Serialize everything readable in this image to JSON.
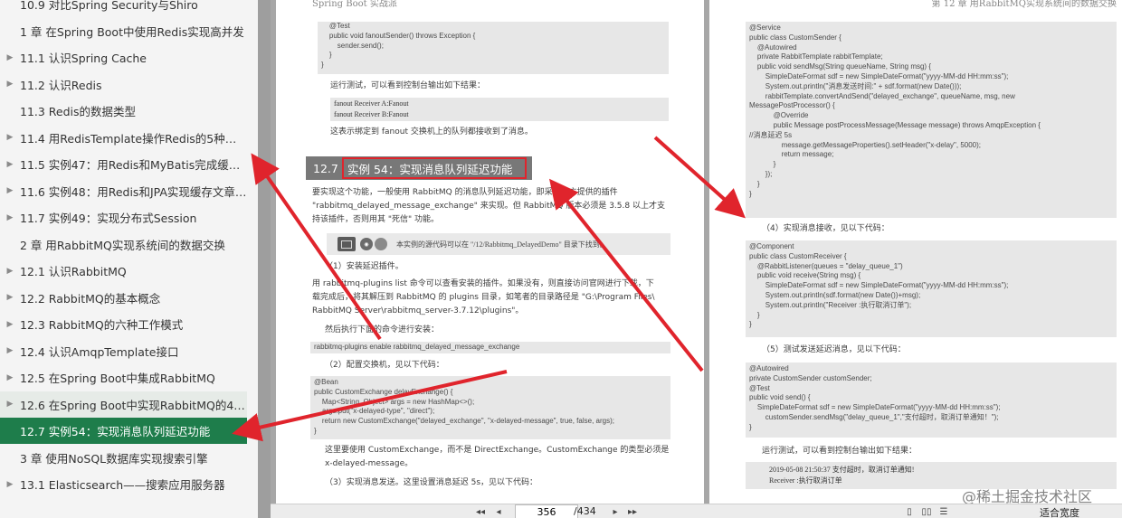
{
  "sidebar": {
    "items": [
      {
        "label": "10.9 对比Spring Security与Shiro",
        "chevron": false,
        "state": "normal"
      },
      {
        "label": "1 章 在Spring Boot中使用Redis实现高并发",
        "chevron": false,
        "state": "normal"
      },
      {
        "label": "11.1 认识Spring Cache",
        "chevron": true,
        "state": "normal"
      },
      {
        "label": "11.2 认识Redis",
        "chevron": true,
        "state": "normal"
      },
      {
        "label": "11.3 Redis的数据类型",
        "chevron": false,
        "state": "normal"
      },
      {
        "label": "11.4 用RedisTemplate操作Redis的5种数据...",
        "chevron": true,
        "state": "normal"
      },
      {
        "label": "11.5 实例47：用Redis和MyBatis完成缓存数...",
        "chevron": true,
        "state": "normal"
      },
      {
        "label": "11.6 实例48：用Redis和JPA实现缓存文章和...",
        "chevron": true,
        "state": "normal"
      },
      {
        "label": "11.7 实例49：实现分布式Session",
        "chevron": true,
        "state": "normal"
      },
      {
        "label": "2 章 用RabbitMQ实现系统间的数据交换",
        "chevron": false,
        "state": "normal"
      },
      {
        "label": "12.1 认识RabbitMQ",
        "chevron": true,
        "state": "normal"
      },
      {
        "label": "12.2 RabbitMQ的基本概念",
        "chevron": true,
        "state": "normal"
      },
      {
        "label": "12.3 RabbitMQ的六种工作模式",
        "chevron": true,
        "state": "normal"
      },
      {
        "label": "12.4 认识AmqpTemplate接口",
        "chevron": true,
        "state": "normal"
      },
      {
        "label": "12.5 在Spring Boot中集成RabbitMQ",
        "chevron": true,
        "state": "normal"
      },
      {
        "label": "12.6 在Spring Boot中实现RabbitMQ的4种...",
        "chevron": true,
        "state": "hover"
      },
      {
        "label": "12.7 实例54：实现消息队列延迟功能",
        "chevron": false,
        "state": "active"
      },
      {
        "label": "3 章 使用NoSQL数据库实现搜索引擎",
        "chevron": false,
        "state": "normal"
      },
      {
        "label": "13.1 Elasticsearch——搜索应用服务器",
        "chevron": true,
        "state": "normal"
      }
    ]
  },
  "left_page": {
    "running_head": "Spring Boot 实战派",
    "code1": "    @Test\n    public void fanoutSender() throws Exception {\n        sender.send();\n    }\n}",
    "para1": "运行测试，可以看到控制台输出如下结果：",
    "output1": "fanout Receiver A:Fanout\nfanout Receiver B:Fanout",
    "para2": "这表示绑定到 fanout 交换机上的队列都接收到了消息。",
    "section_number": "12.7",
    "section_title": "实例 54：实现消息队列延迟功能",
    "para3": "要实现这个功能，一般使用 RabbitMQ 的消息队列延迟功能，即采用官方提供的插件\n\"rabbitmq_delayed_message_exchange\" 来实现。但 RabbitMQ 版本必须是 3.5.8 以上才支\n持该插件，否则用其 \"死信\" 功能。",
    "note": "本实例的源代码可以在 \"/12/Rabbitmq_DelayedDemo\" 目录下找到。",
    "step1": "（1）安装延迟插件。",
    "para4": "用 rabbitmq-plugins list 命令可以查看安装的插件。如果没有，则直接访问官网进行下载，下\n载完成后，将其解压到 RabbitMQ 的 plugins 目录，如笔者的目录路径是 \"G:\\Program Files\\\nRabbitMQ Server\\rabbitmq_server-3.7.12\\plugins\"。",
    "para5": "然后执行下面的命令进行安装：",
    "cmd": "rabbitmq-plugins enable rabbitmq_delayed_message_exchange",
    "step2": "（2）配置交换机，见以下代码：",
    "code2": "@Bean\npublic CustomExchange delayExchange() {\n    Map<String, Object> args = new HashMap<>();\n    args.put(\"x-delayed-type\", \"direct\");\n    return new CustomExchange(\"delayed_exchange\", \"x-delayed-message\", true, false, args);\n}",
    "para6": "这里要使用 CustomExchange，而不是 DirectExchange。CustomExchange 的类型必须是\nx-delayed-message。",
    "step3": "（3）实现消息发送。这里设置消息延迟 5s，见以下代码："
  },
  "right_page": {
    "running_head": "第 12 章  用RabbitMQ实现系统间的数据交换",
    "code1": "@Service\npublic class CustomSender {\n    @Autowired\n    private RabbitTemplate rabbitTemplate;\n    public void sendMsg(String queueName, String msg) {\n        SimpleDateFormat sdf = new SimpleDateFormat(\"yyyy-MM-dd HH:mm:ss\");\n        System.out.println(\"消息发送时间:\" + sdf.format(new Date()));\n        rabbitTemplate.convertAndSend(\"delayed_exchange\", queueName, msg, new\nMessagePostProcessor() {\n            @Override\n            public Message postProcessMessage(Message message) throws AmqpException {\n//消息延迟 5s\n                message.getMessageProperties().setHeader(\"x-delay\", 5000);\n                return message;\n            }\n        });\n    }\n}",
    "step4": "（4）实现消息接收，见以下代码：",
    "code2": "@Component\npublic class CustomReceiver {\n    @RabbitListener(queues = \"delay_queue_1\")\n    public void receive(String msg) {\n        SimpleDateFormat sdf = new SimpleDateFormat(\"yyyy-MM-dd HH:mm:ss\");\n        System.out.println(sdf.format(new Date())+msg);\n        System.out.println(\"Receiver :执行取消订单\");\n    }\n}",
    "step5": "（5）测试发送延迟消息，见以下代码：",
    "code3": "@Autowired\nprivate CustomSender customSender;\n@Test\npublic void send() {\n    SimpleDateFormat sdf = new SimpleDateFormat(\"yyyy-MM-dd HH:mm:ss\");\n        customSender.sendMsg(\"delay_queue_1\",\"支付超时，取消订单通知！\");\n}",
    "para1": "运行测试，可以看到控制台输出如下结果：",
    "output": "2019-05-08 21:50:37 支付超时，取消订单通知!\nReceiver :执行取消订单"
  },
  "toolbar": {
    "current_page": "356",
    "total_pages": "/434",
    "zoom": "适合宽度",
    "first_icon": "◂◂",
    "prev_icon": "◂",
    "next_icon": "▸",
    "last_icon": "▸▸"
  },
  "watermark": "@稀土掘金技术社区",
  "colors": {
    "active": "#1e7d4b",
    "annotation_arrow": "#e0242c"
  }
}
